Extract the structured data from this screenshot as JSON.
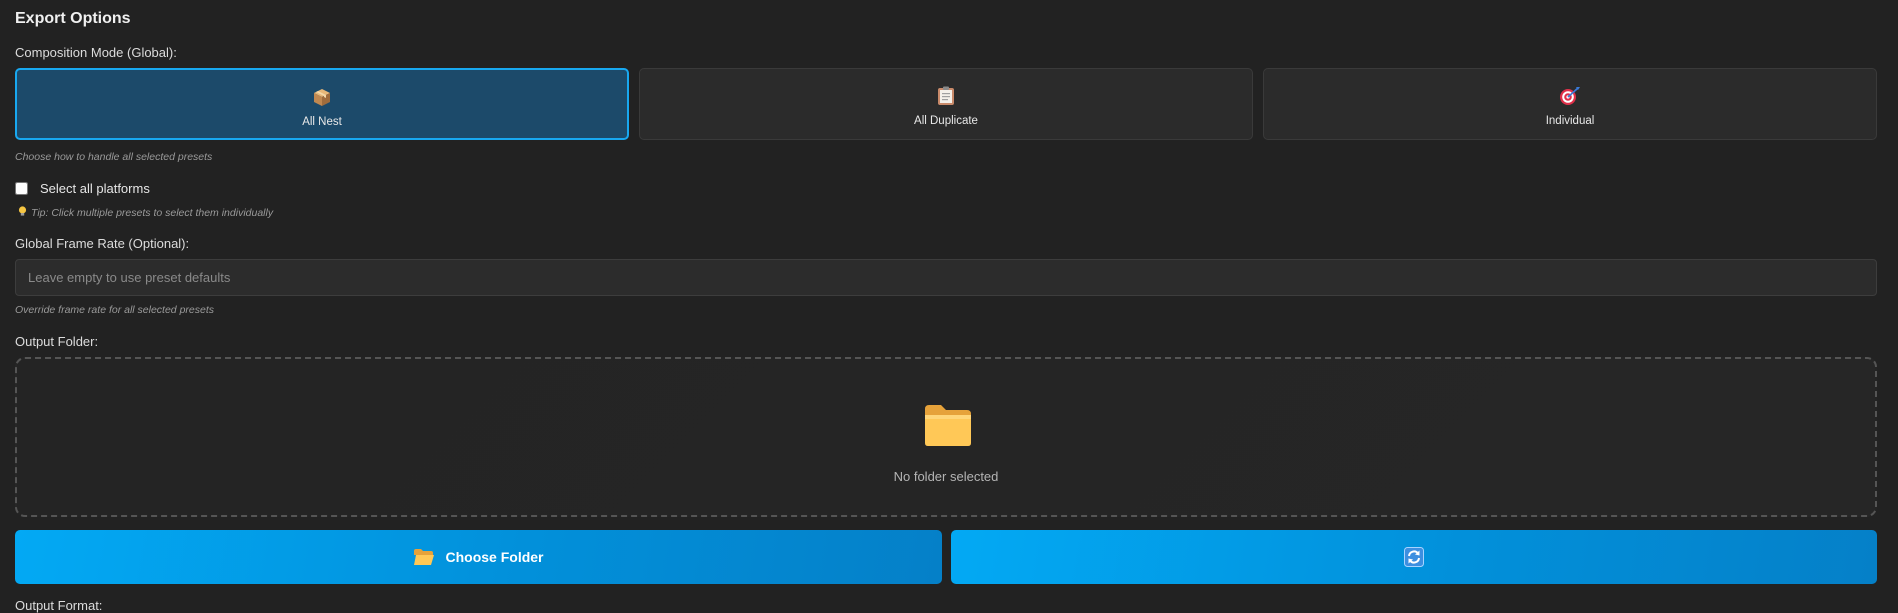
{
  "section": {
    "title": "Export Options"
  },
  "composition": {
    "label": "Composition Mode (Global):",
    "hint": "Choose how to handle all selected presets",
    "modes": [
      {
        "label": "All Nest",
        "icon": "package-icon",
        "active": true
      },
      {
        "label": "All Duplicate",
        "icon": "clipboard-icon",
        "active": false
      },
      {
        "label": "Individual",
        "icon": "target-icon",
        "active": false
      }
    ]
  },
  "platforms": {
    "label": "Select all platforms",
    "checked": false,
    "tip": "Tip: Click multiple presets to select them individually"
  },
  "frame_rate": {
    "label": "Global Frame Rate (Optional):",
    "value": "",
    "placeholder": "Leave empty to use preset defaults",
    "hint": "Override frame rate for all selected presets"
  },
  "output": {
    "label": "Output Folder:",
    "empty_text": "No folder selected",
    "choose_label": "Choose Folder",
    "choose_icon": "open-folder-icon",
    "refresh_icon": "refresh-icon"
  },
  "next_section": {
    "label": "Output Format:"
  },
  "colors": {
    "accent": "#03a9f4",
    "active_mode_bg": "#1c4a6a",
    "active_mode_border": "#18a8f0",
    "background": "#222222"
  }
}
